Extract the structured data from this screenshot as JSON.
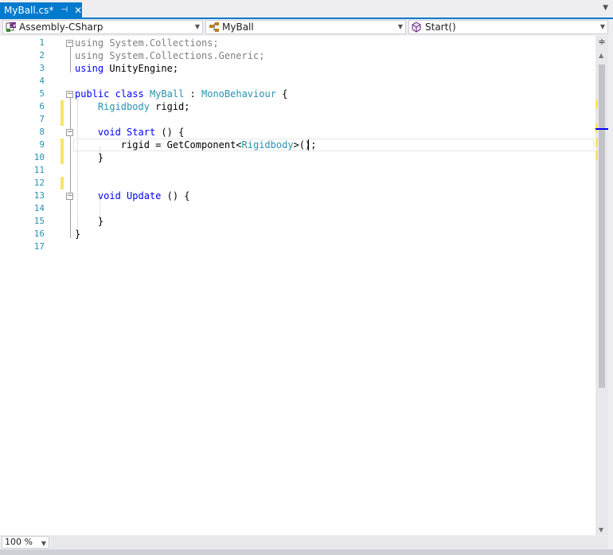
{
  "tab": {
    "title": "MyBall.cs*",
    "pin": "⊣",
    "close": "✕"
  },
  "nav": {
    "project": "Assembly-CSharp",
    "type": "MyBall",
    "member": "Start()"
  },
  "editor": {
    "line_numbers": [
      "1",
      "2",
      "3",
      "4",
      "5",
      "6",
      "7",
      "8",
      "9",
      "10",
      "11",
      "12",
      "13",
      "14",
      "15",
      "16",
      "17"
    ],
    "lines": [
      [
        {
          "t": "using",
          "c": "gray"
        },
        {
          "t": " System.Collections;",
          "c": "gray"
        }
      ],
      [
        {
          "t": "using",
          "c": "gray"
        },
        {
          "t": " System.Collections.Generic;",
          "c": "gray"
        }
      ],
      [
        {
          "t": "using",
          "c": "kw"
        },
        {
          "t": " UnityEngine;",
          "c": ""
        }
      ],
      [],
      [
        {
          "t": "public",
          "c": "kw"
        },
        {
          "t": " ",
          "c": ""
        },
        {
          "t": "class",
          "c": "kw"
        },
        {
          "t": " ",
          "c": ""
        },
        {
          "t": "MyBall",
          "c": "ty"
        },
        {
          "t": " : ",
          "c": ""
        },
        {
          "t": "MonoBehaviour",
          "c": "ty"
        },
        {
          "t": " {",
          "c": ""
        }
      ],
      [
        {
          "t": "    ",
          "c": ""
        },
        {
          "t": "Rigidbody",
          "c": "ty"
        },
        {
          "t": " rigid;",
          "c": ""
        }
      ],
      [],
      [
        {
          "t": "    ",
          "c": ""
        },
        {
          "t": "void",
          "c": "kw"
        },
        {
          "t": " ",
          "c": ""
        },
        {
          "t": "Start",
          "c": "kw"
        },
        {
          "t": " () {",
          "c": ""
        }
      ],
      [
        {
          "t": "        rigid = GetComponent<",
          "c": ""
        },
        {
          "t": "Rigidbody",
          "c": "ty"
        },
        {
          "t": ">();",
          "c": ""
        }
      ],
      [
        {
          "t": "    }",
          "c": ""
        }
      ],
      [],
      [],
      [
        {
          "t": "    ",
          "c": ""
        },
        {
          "t": "void",
          "c": "kw"
        },
        {
          "t": " ",
          "c": ""
        },
        {
          "t": "Update",
          "c": "kw"
        },
        {
          "t": " () {",
          "c": ""
        }
      ],
      [],
      [
        {
          "t": "    }",
          "c": ""
        }
      ],
      [
        {
          "t": "}",
          "c": ""
        }
      ],
      []
    ],
    "changed_lines": [
      "6",
      "7",
      "9",
      "10",
      "12"
    ],
    "fold_lines": [
      "1",
      "5",
      "8",
      "13"
    ]
  },
  "zoom": "100 %",
  "colors": {
    "accent": "#007acc",
    "keyword": "#0000ff",
    "type": "#2b91af",
    "line_number": "#2b91af",
    "change_marker": "#f5e56b"
  }
}
